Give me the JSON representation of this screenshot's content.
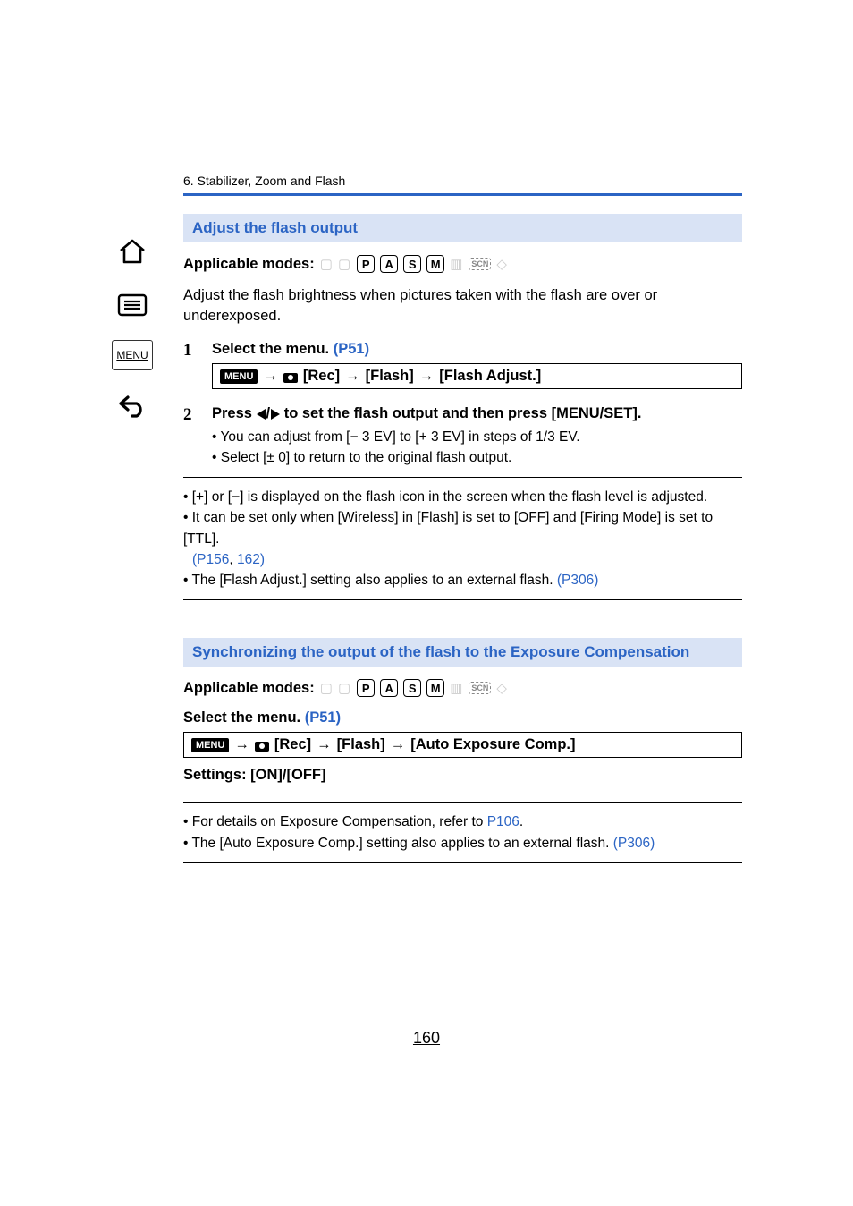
{
  "chapter": "6. Stabilizer, Zoom and Flash",
  "sidebar": {
    "menu_label": "MENU"
  },
  "modes": {
    "label": "Applicable modes:",
    "active": [
      "P",
      "A",
      "S",
      "M"
    ],
    "scn": "SCN"
  },
  "section1": {
    "title": "Adjust the flash output",
    "intro": "Adjust the flash brightness when pictures taken with the flash are over or underexposed.",
    "step1_num": "1",
    "step1_title_pre": "Select the menu. ",
    "step1_link": "(P51)",
    "menu_chip": "MENU",
    "path1": "[Rec]",
    "path2": "[Flash]",
    "path3": "[Flash Adjust.]",
    "step2_num": "2",
    "step2_title_pre": "Press ",
    "step2_title_post": " to set the flash output and then press [MENU/SET].",
    "step2_b1": "You can adjust from [− 3 EV] to [+ 3 EV] in steps of 1/3 EV.",
    "step2_b2": "Select [± 0] to return to the original flash output.",
    "note1": "[+] or [−] is displayed on the flash icon in the screen when the flash level is adjusted.",
    "note2": "It can be set only when [Wireless] in [Flash] is set to [OFF] and [Firing Mode] is set to [TTL]. ",
    "note2_link": "(P156",
    "note2_link2": "162)",
    "note3_pre": "The [Flash Adjust.] setting also applies to an external flash. ",
    "note3_link": "(P306)"
  },
  "section2": {
    "title": "Synchronizing the output of the flash to the Exposure Compensation",
    "select_pre": "Select the menu. ",
    "select_link": "(P51)",
    "menu_chip": "MENU",
    "path1": "[Rec]",
    "path2": "[Flash]",
    "path3": "[Auto Exposure Comp.]",
    "settings": "Settings: [ON]/[OFF]",
    "note1_pre": "For details on Exposure Compensation, refer to ",
    "note1_link": "P106",
    "note1_post": ".",
    "note2_pre": "The [Auto Exposure Comp.] setting also applies to an external flash. ",
    "note2_link": "(P306)"
  },
  "page_number": "160"
}
